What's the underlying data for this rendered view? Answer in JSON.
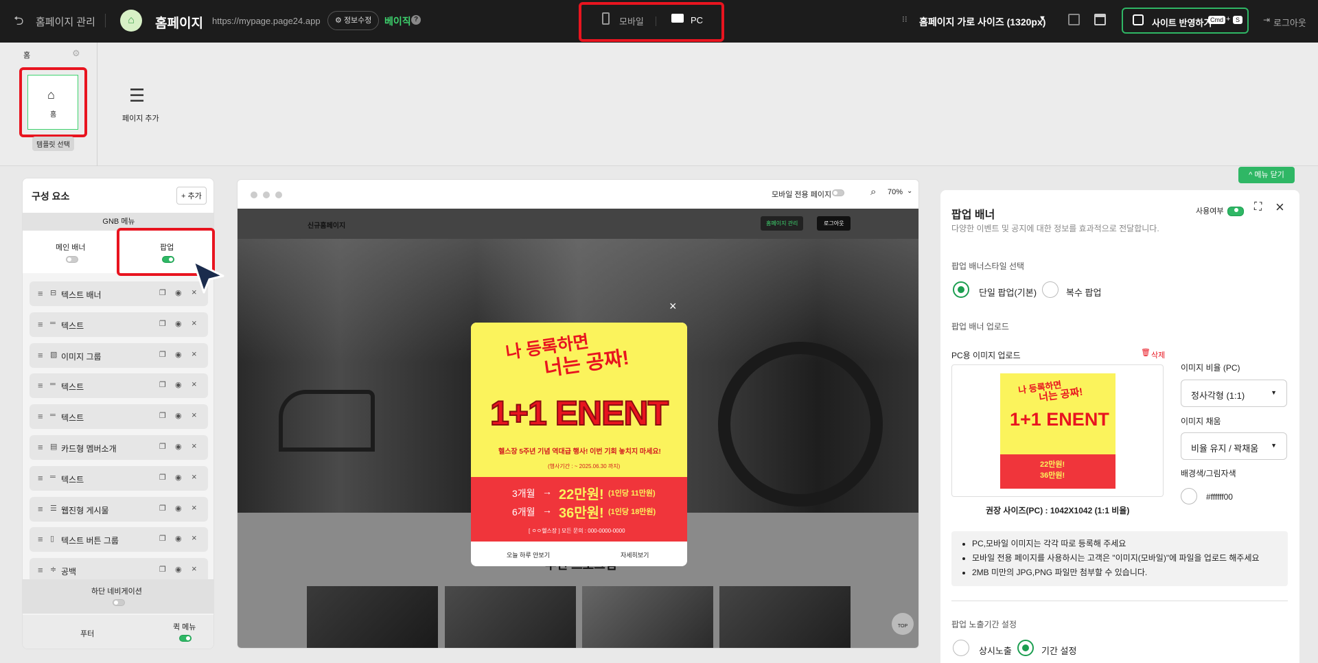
{
  "topbar": {
    "back_label": "홈페이지 관리",
    "site_name": "홈페이지",
    "site_url": "https://mypage.page24.app",
    "info_edit": "정보수정",
    "plan": "베이직",
    "mode_mobile": "모바일",
    "mode_pc": "PC",
    "width_label": "홈페이지 가로 사이즈 (1320px)",
    "publish_label": "사이트 반영하기",
    "shortcut_cmd": "Cmd",
    "shortcut_plus": "+",
    "shortcut_key": "S",
    "logout": "로그아웃"
  },
  "pagebar": {
    "home_header": "홈",
    "home_card": "홈",
    "template_select": "템플릿 선택",
    "add_page": "페이지 추가",
    "close_menu": "메뉴 닫기"
  },
  "components": {
    "title": "구성 요소",
    "add": "+ 추가",
    "gnb": "GNB 메뉴",
    "main_banner": "메인 배너",
    "popup": "팝업",
    "items": [
      {
        "icon": "⊟",
        "label": "텍스트 배너"
      },
      {
        "icon": "═",
        "label": "텍스트"
      },
      {
        "icon": "▧",
        "label": "이미지 그룹"
      },
      {
        "icon": "═",
        "label": "텍스트"
      },
      {
        "icon": "═",
        "label": "텍스트"
      },
      {
        "icon": "▤",
        "label": "카드형 멤버소개"
      },
      {
        "icon": "═",
        "label": "텍스트"
      },
      {
        "icon": "☰",
        "label": "웹진형 게시물"
      },
      {
        "icon": "▯",
        "label": "텍스트 버튼 그룹"
      },
      {
        "icon": "≑",
        "label": "공백"
      }
    ],
    "bottom_nav": "하단 네비게이션",
    "footer": "푸터",
    "quick_menu": "퀵 메뉴"
  },
  "preview": {
    "mobile_only": "모바일 전용 페이지",
    "zoom": "70%",
    "site_title": "신규홈페이지",
    "admin_btn": "홈페이지 관리",
    "logout_btn": "로그아웃",
    "section_title": "추천 프로그램",
    "top_btn": "TOP",
    "popup": {
      "line1": "나 등록하면",
      "line2": "너는 공짜!",
      "headline": "1+1 ENENT",
      "sub": "헬스장 5주년 기념 역대급 행사! 이번 기회 놓치지 마세요!",
      "period": "(행사기간 : ~ 2025.06.30 까지)",
      "offer1_term": "3개월",
      "offer1_price": "22만원!",
      "offer1_note": "(1인당 11만원)",
      "offer2_term": "6개월",
      "offer2_price": "36만원!",
      "offer2_note": "(1인당 18만원)",
      "contact": "[ ㅇㅇ헬스장 ] 모든 문의 : 000-0000-0000",
      "dont_show": "오늘 하루 안보기",
      "details": "자세히보기"
    }
  },
  "settings": {
    "title": "팝업 배너",
    "desc": "다양한 이벤트 및 공지에 대한 정보를 효과적으로 전달합니다.",
    "use_label": "사용여부",
    "style_section": "팝업 배너스타일 선택",
    "style_single": "단일 팝업(기본)",
    "style_multi": "복수 팝업",
    "upload_section": "팝업 배너 업로드",
    "pc_upload": "PC용 이미지 업로드",
    "delete": "삭제",
    "ratio_label": "이미지 비율 (PC)",
    "ratio_value": "정사각형 (1:1)",
    "fill_label": "이미지 채움",
    "fill_value": "비율 유지 / 꽉채움",
    "bg_label": "배경색/그림자색",
    "bg_value": "#ffffff00",
    "recommend": "권장 사이즈(PC) : 1042X1042 (1:1 비율)",
    "notes": [
      "PC,모바일 이미지는 각각 따로 등록해 주세요",
      "모바일 전용 페이지를 사용하시는 고객은 \"이미지(모바일)\"에 파일을 업로드 해주세요",
      "2MB 미만의 JPG,PNG 파일만 첨부할 수 있습니다."
    ],
    "period_section": "팝업 노출기간 설정",
    "period_always": "상시노출",
    "period_range": "기간 설정"
  },
  "colors": {
    "accent_green": "#1c9e50",
    "highlight_red": "#e8141f",
    "popup_yellow": "#fbf35c",
    "popup_red": "#f0353b"
  }
}
